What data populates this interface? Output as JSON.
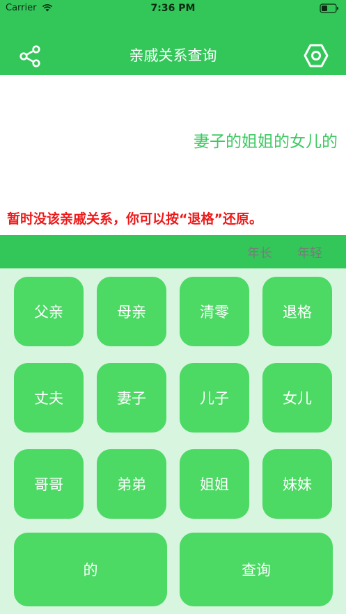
{
  "status_bar": {
    "carrier": "Carrier",
    "time": "7:36 PM"
  },
  "nav": {
    "title": "亲戚关系查询",
    "left_icon": "share-icon",
    "right_icon": "settings-icon"
  },
  "display": {
    "expression": "妻子的姐姐的女儿的",
    "result": "暂时没该亲戚关系，你可以按“退格”还原。"
  },
  "options": {
    "older": "年长",
    "younger": "年轻"
  },
  "keys": {
    "father": "父亲",
    "mother": "母亲",
    "clear": "清零",
    "backspace": "退格",
    "husband": "丈夫",
    "wife": "妻子",
    "son": "儿子",
    "daughter": "女儿",
    "elder_brother": "哥哥",
    "younger_brother": "弟弟",
    "elder_sister": "姐姐",
    "younger_sister": "妹妹",
    "of": "的",
    "query": "查询"
  },
  "colors": {
    "primary": "#33c75a",
    "key": "#4cd964",
    "background": "#d7f5df",
    "expression": "#3cc960",
    "error": "#f01818"
  }
}
